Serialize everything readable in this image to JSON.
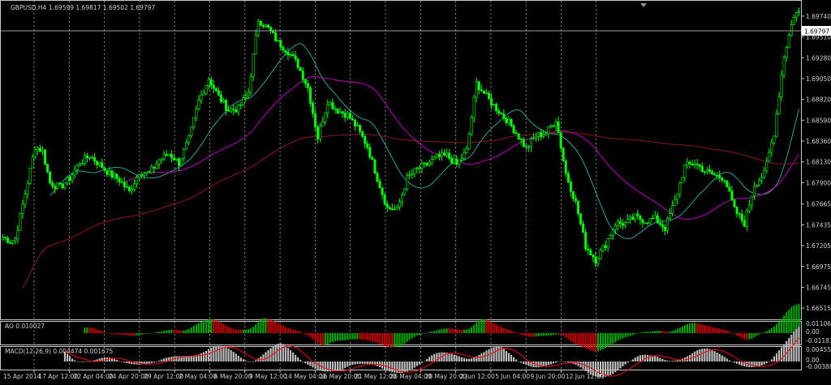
{
  "chart_data": [
    {
      "type": "candlestick",
      "title": "GBPUSD,H4",
      "ohlc_header": "1.69599 1.69817 1.69502 1.69797",
      "current_price_label": "1.69797",
      "ylim": [
        1.664,
        1.699
      ],
      "y_ticks": [
        "1.69970",
        "1.69740",
        "1.69510",
        "1.69280",
        "1.69050",
        "1.68820",
        "1.68590",
        "1.68360",
        "1.68130",
        "1.67900",
        "1.67665",
        "1.67435",
        "1.67205",
        "1.66975",
        "1.66745",
        "1.66515"
      ],
      "x_ticks": [
        "15 Apr 2014",
        "17 Apr 12:00",
        "22 Apr 04:00",
        "24 Apr 20:00",
        "29 Apr 12:00",
        "2 May 04:00",
        "6 May 20:00",
        "9 May 12:00",
        "14 May 04:00",
        "16 May 20:00",
        "21 May 12:00",
        "26 May 04:00",
        "28 May 20:00",
        "2 Jun 12:00",
        "5 Jun 04:00",
        "9 Jun 20:00",
        "12 Jun 12:00"
      ],
      "anchors": [
        [
          0,
          1.673
        ],
        [
          3,
          1.6725
        ],
        [
          5,
          1.6728
        ],
        [
          9,
          1.6778
        ],
        [
          13,
          1.683
        ],
        [
          16,
          1.6825
        ],
        [
          19,
          1.679
        ],
        [
          23,
          1.6785
        ],
        [
          27,
          1.6795
        ],
        [
          31,
          1.6812
        ],
        [
          35,
          1.682
        ],
        [
          39,
          1.681
        ],
        [
          43,
          1.68
        ],
        [
          47,
          1.6793
        ],
        [
          51,
          1.678
        ],
        [
          55,
          1.6802
        ],
        [
          59,
          1.68
        ],
        [
          63,
          1.6815
        ],
        [
          67,
          1.6822
        ],
        [
          71,
          1.6812
        ],
        [
          75,
          1.6838
        ],
        [
          79,
          1.688
        ],
        [
          83,
          1.6905
        ],
        [
          87,
          1.6885
        ],
        [
          91,
          1.687
        ],
        [
          95,
          1.6872
        ],
        [
          99,
          1.689
        ],
        [
          103,
          1.697
        ],
        [
          107,
          1.696
        ],
        [
          111,
          1.6945
        ],
        [
          115,
          1.6935
        ],
        [
          119,
          1.692
        ],
        [
          123,
          1.6895
        ],
        [
          127,
          1.684
        ],
        [
          131,
          1.688
        ],
        [
          135,
          1.687
        ],
        [
          139,
          1.6865
        ],
        [
          143,
          1.685
        ],
        [
          147,
          1.683
        ],
        [
          151,
          1.6795
        ],
        [
          155,
          1.6762
        ],
        [
          159,
          1.676
        ],
        [
          163,
          1.6795
        ],
        [
          167,
          1.6805
        ],
        [
          171,
          1.681
        ],
        [
          175,
          1.6818
        ],
        [
          179,
          1.682
        ],
        [
          183,
          1.681
        ],
        [
          187,
          1.6825
        ],
        [
          191,
          1.69
        ],
        [
          195,
          1.6885
        ],
        [
          199,
          1.6872
        ],
        [
          203,
          1.686
        ],
        [
          207,
          1.6845
        ],
        [
          211,
          1.6828
        ],
        [
          215,
          1.6842
        ],
        [
          219,
          1.6845
        ],
        [
          223,
          1.686
        ],
        [
          227,
          1.68
        ],
        [
          231,
          1.6768
        ],
        [
          235,
          1.672
        ],
        [
          239,
          1.6705
        ],
        [
          243,
          1.6722
        ],
        [
          247,
          1.6745
        ],
        [
          251,
          1.6745
        ],
        [
          255,
          1.6752
        ],
        [
          259,
          1.6748
        ],
        [
          263,
          1.675
        ],
        [
          267,
          1.674
        ],
        [
          271,
          1.677
        ],
        [
          275,
          1.6808
        ],
        [
          279,
          1.6812
        ],
        [
          283,
          1.6803
        ],
        [
          287,
          1.6798
        ],
        [
          291,
          1.6795
        ],
        [
          295,
          1.676
        ],
        [
          299,
          1.6745
        ],
        [
          303,
          1.6788
        ],
        [
          307,
          1.68
        ],
        [
          311,
          1.6845
        ],
        [
          315,
          1.693
        ],
        [
          319,
          1.6975
        ],
        [
          321,
          1.698
        ]
      ],
      "moving_averages": [
        {
          "color": "#26a69a",
          "period": 20
        },
        {
          "color": "#c000c0",
          "period": 50
        },
        {
          "color": "#8b1a1a",
          "period": 200
        }
      ],
      "up_color": "#00ff00",
      "down_color": "#00ff00"
    },
    {
      "type": "histogram",
      "indicator": "AO",
      "label": "AO 0.010027",
      "y_ticks": [
        "0.011068",
        "0.00",
        "-0.01183"
      ],
      "pos_color": "#00aa00",
      "neg_color": "#cc0000"
    },
    {
      "type": "histogram",
      "indicator": "MACD",
      "label": "MACD(12,26,9) 0.004474 0.001675",
      "y_ticks": [
        "0.004558",
        "0.00",
        "-0.003885"
      ],
      "bar_color": "#c0c0c0",
      "signal_color": "#ff0000"
    }
  ],
  "theme": {
    "background": "#000000",
    "grid": "#c8c8c8",
    "text": "#d0d0d0",
    "border": "#c8c8c8"
  }
}
